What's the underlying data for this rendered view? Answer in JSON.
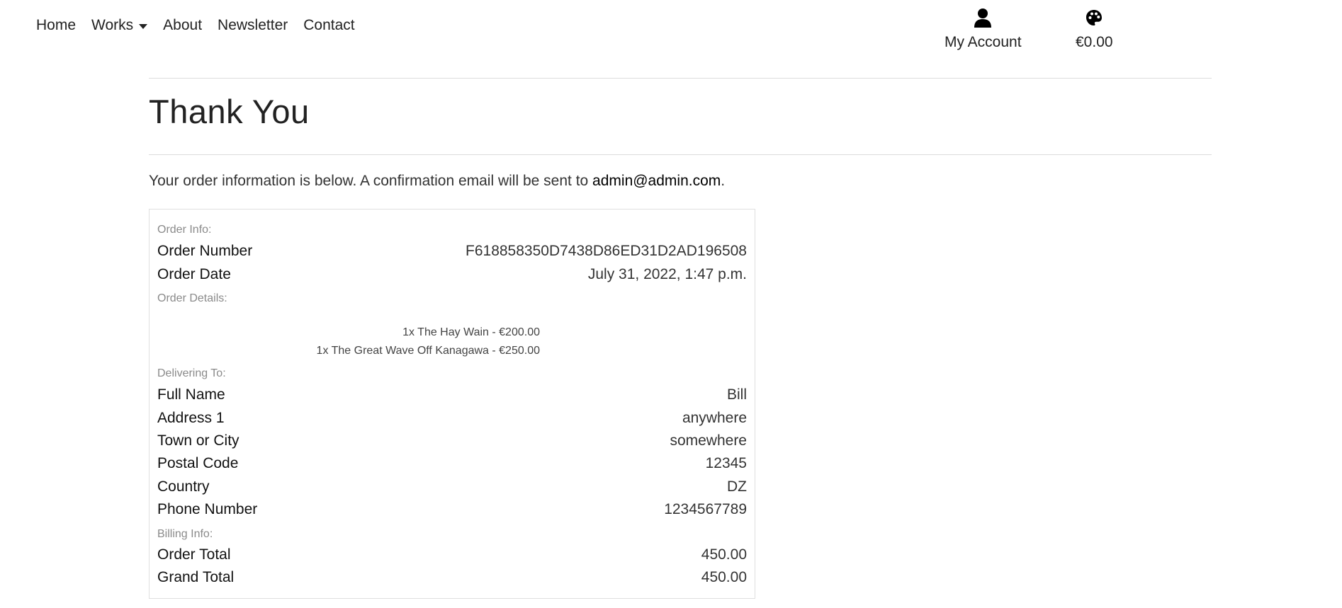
{
  "nav": {
    "items": [
      {
        "label": "Home"
      },
      {
        "label": "Works"
      },
      {
        "label": "About"
      },
      {
        "label": "Newsletter"
      },
      {
        "label": "Contact"
      }
    ],
    "account_label": "My Account",
    "bag_total": "€0.00"
  },
  "page": {
    "title": "Thank You",
    "intro_text": "Your order information is below. A confirmation email will be sent to ",
    "intro_email": "admin@admin.com",
    "intro_end": "."
  },
  "order": {
    "info_heading": "Order Info:",
    "order_number_label": "Order Number",
    "order_number": "F618858350D7438D86ED31D2AD196508",
    "order_date_label": "Order Date",
    "order_date": "July 31, 2022, 1:47 p.m.",
    "details_heading": "Order Details:",
    "line_items": [
      "1x The Hay Wain - €200.00",
      "1x The Great Wave Off Kanagawa - €250.00"
    ],
    "delivery_heading": "Delivering To:",
    "delivery": [
      {
        "label": "Full Name",
        "value": "Bill"
      },
      {
        "label": "Address 1",
        "value": "anywhere"
      },
      {
        "label": "Town or City",
        "value": "somewhere"
      },
      {
        "label": "Postal Code",
        "value": "12345"
      },
      {
        "label": "Country",
        "value": "DZ"
      },
      {
        "label": "Phone Number",
        "value": "1234567789"
      }
    ],
    "billing_heading": "Billing Info:",
    "billing": [
      {
        "label": "Order Total",
        "value": "450.00"
      },
      {
        "label": "Grand Total",
        "value": "450.00"
      }
    ]
  },
  "icons": {
    "account": "user-icon",
    "bag": "palette-icon"
  }
}
